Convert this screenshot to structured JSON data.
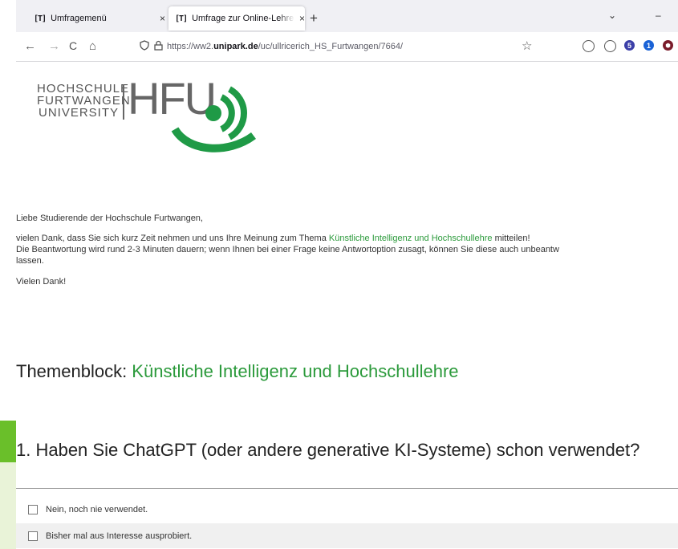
{
  "tabs": [
    {
      "favicon": "[T]",
      "label": "Umfragemenü",
      "close": "×"
    },
    {
      "favicon": "[T]",
      "label": "Umfrage zur Online-Lehre im So",
      "close": "×"
    }
  ],
  "new_tab": "+",
  "window": {
    "dropdown": "⌄",
    "minimize": "–"
  },
  "nav": {
    "back": "←",
    "forward": "→",
    "reload": "C",
    "home": "⌂",
    "url_prefix": "https://ww2.",
    "url_domain": "unipark.de",
    "url_path": "/uc/ullricerich_HS_Furtwangen/7664/",
    "extensions": [
      "5",
      "1"
    ]
  },
  "logo": {
    "line1": "HOCHSCHULE",
    "line2": "FURTWANGEN",
    "line3": "UNIVERSITY",
    "hfu": "HFU"
  },
  "intro": {
    "greeting": "Liebe Studierende der Hochschule Furtwangen,",
    "p1_a": "vielen Dank, dass Sie sich kurz Zeit nehmen und uns Ihre Meinung zum Thema ",
    "p1_topic": "Künstliche Intelligenz und Hochschullehre",
    "p1_b": " mitteilen!",
    "p2": "Die Beantwortung wird rund 2-3 Minuten dauern; wenn Ihnen bei einer Frage keine Antwortoption zusagt, können Sie diese auch unbeantw",
    "p2_cont": "lassen.",
    "thanks": "Vielen Dank!"
  },
  "theme": {
    "label": "Themenblock: ",
    "topic": "Künstliche Intelligenz und Hochschullehre"
  },
  "question1": {
    "text": "1. Haben Sie ChatGPT (oder andere generative KI-Systeme) schon verwendet?",
    "options": [
      "Nein, noch nie verwendet.",
      "Bisher mal aus Interesse ausprobiert."
    ]
  },
  "colors": {
    "accent_green": "#2b9a3b",
    "logo_green": "#1f9a46"
  }
}
